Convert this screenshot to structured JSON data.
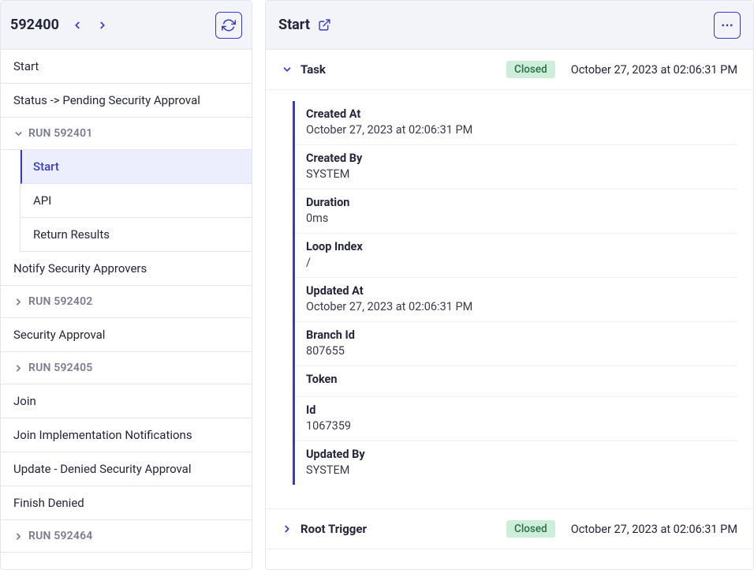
{
  "left": {
    "run_id": "592400",
    "items": [
      {
        "type": "row",
        "label": "Start"
      },
      {
        "type": "row",
        "label": "Status -> Pending Security Approval"
      },
      {
        "type": "run",
        "open": true,
        "run_label": "RUN 592401",
        "children": [
          {
            "label": "Start",
            "active": true
          },
          {
            "label": "API"
          },
          {
            "label": "Return Results"
          }
        ]
      },
      {
        "type": "row",
        "label": "Notify Security Approvers"
      },
      {
        "type": "run",
        "open": false,
        "run_label": "RUN 592402"
      },
      {
        "type": "row",
        "label": "Security Approval"
      },
      {
        "type": "run",
        "open": false,
        "run_label": "RUN 592405"
      },
      {
        "type": "row",
        "label": "Join"
      },
      {
        "type": "row",
        "label": "Join Implementation Notifications"
      },
      {
        "type": "row",
        "label": "Update - Denied Security Approval"
      },
      {
        "type": "row",
        "label": "Finish Denied"
      },
      {
        "type": "run",
        "open": false,
        "run_label": "RUN 592464"
      }
    ]
  },
  "right": {
    "title": "Start",
    "sections": {
      "task": {
        "name": "Task",
        "status": "Closed",
        "timestamp": "October 27, 2023 at 02:06:31 PM",
        "fields": [
          {
            "label": "Created At",
            "value": "October 27, 2023 at 02:06:31 PM"
          },
          {
            "label": "Created By",
            "value": "SYSTEM"
          },
          {
            "label": "Duration",
            "value": "0ms"
          },
          {
            "label": "Loop Index",
            "value": "/"
          },
          {
            "label": "Updated At",
            "value": "October 27, 2023 at 02:06:31 PM"
          },
          {
            "label": "Branch Id",
            "value": "807655"
          },
          {
            "label": "Token",
            "value": ""
          },
          {
            "label": "Id",
            "value": "1067359"
          },
          {
            "label": "Updated By",
            "value": "SYSTEM"
          }
        ]
      },
      "root_trigger": {
        "name": "Root Trigger",
        "status": "Closed",
        "timestamp": "October 27, 2023 at 02:06:31 PM"
      }
    }
  }
}
